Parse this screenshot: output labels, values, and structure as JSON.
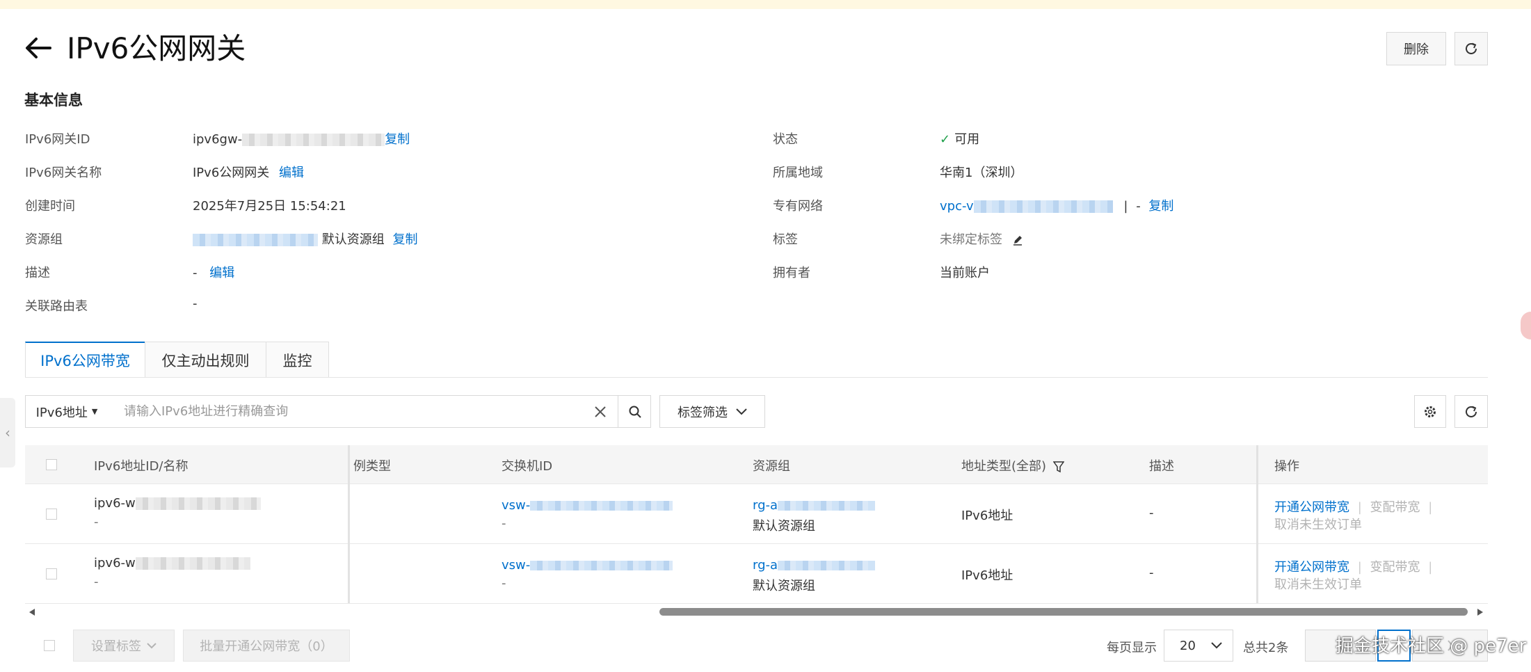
{
  "header": {
    "title": "IPv6公网网关",
    "delete_label": "删除"
  },
  "basic_info": {
    "section_title": "基本信息",
    "left": {
      "gateway_id_label": "IPv6网关ID",
      "gateway_id_prefix": "ipv6gw-",
      "copy_label": "复制",
      "gateway_name_label": "IPv6网关名称",
      "gateway_name_value": "IPv6公网网关",
      "edit_label": "编辑",
      "created_label": "创建时间",
      "created_value": "2025年7月25日 15:54:21",
      "resource_group_label": "资源组",
      "resource_group_value": "默认资源组",
      "description_label": "描述",
      "description_value": "-",
      "route_table_label": "关联路由表",
      "route_table_value": "-"
    },
    "right": {
      "status_label": "状态",
      "status_value": "可用",
      "region_label": "所属地域",
      "region_value": "华南1（深圳）",
      "vpc_label": "专有网络",
      "vpc_prefix": "vpc-v",
      "vpc_pipe": "|",
      "vpc_dash": "-",
      "copy_label": "复制",
      "tags_label": "标签",
      "tags_value": "未绑定标签",
      "owner_label": "拥有者",
      "owner_value": "当前账户"
    }
  },
  "tabs": [
    {
      "label": "IPv6公网带宽",
      "active": true
    },
    {
      "label": "仅主动出规则",
      "active": false
    },
    {
      "label": "监控",
      "active": false
    }
  ],
  "search": {
    "type_label": "IPv6地址",
    "placeholder": "请输入IPv6地址进行精确查询",
    "tag_filter_label": "标签筛选"
  },
  "table": {
    "columns": [
      "IPv6地址ID/名称",
      "例类型",
      "交换机ID",
      "资源组",
      "地址类型(全部)",
      "描述",
      "操作"
    ],
    "rows": [
      {
        "id_prefix": "ipv6-w",
        "name": "-",
        "vsw_prefix": "vsw-",
        "vsw_sub": "-",
        "rg_prefix": "rg-a",
        "rg_name": "默认资源组",
        "addr_type": "IPv6地址",
        "desc": "-",
        "action_open": "开通公网带宽",
        "action_change": "变配带宽",
        "action_cancel": "取消未生效订单"
      },
      {
        "id_prefix": "ipv6-w",
        "name": "-",
        "vsw_prefix": "vsw-",
        "vsw_sub": "-",
        "rg_prefix": "rg-a",
        "rg_name": "默认资源组",
        "addr_type": "IPv6地址",
        "desc": "-",
        "action_open": "开通公网带宽",
        "action_change": "变配带宽",
        "action_cancel": "取消未生效订单"
      }
    ]
  },
  "footer": {
    "set_tags_label": "设置标签",
    "batch_open_label": "批量开通公网带宽（0）",
    "per_page_label": "每页显示",
    "per_page_value": "20",
    "total_label": "总共2条"
  },
  "watermark": "掘金技术社区 @ pe7er",
  "colors": {
    "link": "#0070cc",
    "status_ok": "#1fa04a",
    "topbar": "#fff8e1"
  }
}
